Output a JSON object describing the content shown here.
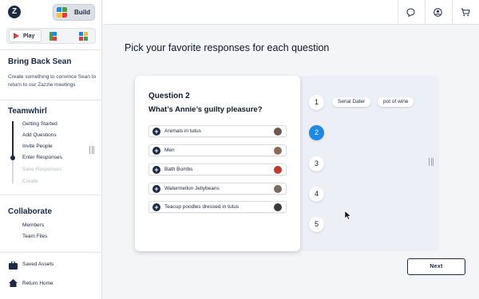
{
  "sidebar": {
    "build_label": "Build",
    "play_label": "Play",
    "project_title": "Bring Back Sean",
    "project_desc": "Create something to convince Sean to return to our Zazzle meetings",
    "teamwhirl": {
      "title": "Teamwhirl",
      "steps": [
        {
          "label": "Getting Started",
          "state": "done"
        },
        {
          "label": "Add Questions",
          "state": "done"
        },
        {
          "label": "Invite People",
          "state": "done"
        },
        {
          "label": "Enter Responses",
          "state": "current"
        },
        {
          "label": "Save Responses",
          "state": "disabled"
        },
        {
          "label": "Create",
          "state": "disabled"
        }
      ]
    },
    "collaborate": {
      "title": "Collaborate",
      "items": [
        "Members",
        "Team Files"
      ]
    },
    "footer": {
      "saved_assets": "Saved Assets",
      "return_home": "Return Home"
    }
  },
  "topbar": {
    "icons": [
      "chat-icon",
      "user-icon",
      "cart-icon"
    ]
  },
  "main": {
    "headline": "Pick your favorite responses for each question",
    "question_number": "Question 2",
    "question_text": "What’s Annie’s guilty pleasure?",
    "responses": [
      {
        "text": "Animals in tutus",
        "avatar_color": "#6d5a4b"
      },
      {
        "text": "Men",
        "avatar_color": "#8a6b5a"
      },
      {
        "text": "Bath Bombs",
        "avatar_color": "#c0392b"
      },
      {
        "text": "Watermellon Jellybeans",
        "avatar_color": "#7a6a62"
      },
      {
        "text": "Teacup poodles dressed in tutus",
        "avatar_color": "#3b3b3b"
      }
    ],
    "ranks": [
      {
        "label": "1",
        "active": false
      },
      {
        "label": "2",
        "active": true
      },
      {
        "label": "3",
        "active": false
      },
      {
        "label": "4",
        "active": false
      },
      {
        "label": "5",
        "active": false
      }
    ],
    "rank1_chips": [
      "Serial Dater",
      "pot of wine"
    ],
    "next_label": "Next"
  },
  "colors": {
    "navy": "#1d2a44",
    "accent_blue": "#1e88e5",
    "panel": "#ecf0f6"
  }
}
